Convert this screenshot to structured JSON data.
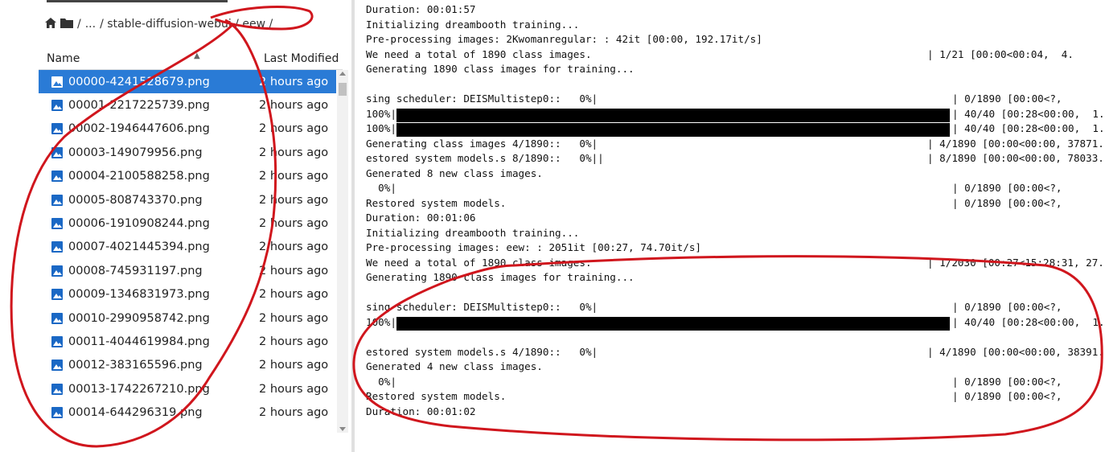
{
  "breadcrumb": {
    "root": "/",
    "ellipsis": "...",
    "path": "/ stable-diffusion-webui / eew /"
  },
  "file_browser": {
    "col_name": "Name",
    "col_modified": "Last Modified",
    "files": [
      {
        "name": "00000-4241528679.png",
        "modified": "2 hours ago",
        "selected": true
      },
      {
        "name": "00001-2217225739.png",
        "modified": "2 hours ago"
      },
      {
        "name": "00002-1946447606.png",
        "modified": "2 hours ago"
      },
      {
        "name": "00003-149079956.png",
        "modified": "2 hours ago"
      },
      {
        "name": "00004-2100588258.png",
        "modified": "2 hours ago"
      },
      {
        "name": "00005-808743370.png",
        "modified": "2 hours ago"
      },
      {
        "name": "00006-1910908244.png",
        "modified": "2 hours ago"
      },
      {
        "name": "00007-4021445394.png",
        "modified": "2 hours ago"
      },
      {
        "name": "00008-745931197.png",
        "modified": "2 hours ago"
      },
      {
        "name": "00009-1346831973.png",
        "modified": "2 hours ago"
      },
      {
        "name": "00010-2990958742.png",
        "modified": "2 hours ago"
      },
      {
        "name": "00011-4044619984.png",
        "modified": "2 hours ago"
      },
      {
        "name": "00012-383165596.png",
        "modified": "2 hours ago"
      },
      {
        "name": "00013-1742267210.png",
        "modified": "2 hours ago"
      },
      {
        "name": "00014-644296319.png",
        "modified": "2 hours ago"
      }
    ]
  },
  "console": [
    {
      "text": "Duration: 00:01:57",
      "right": "",
      "bar_progress": null
    },
    {
      "text": "Initializing dreambooth training...",
      "right": "",
      "bar_progress": null
    },
    {
      "text": "Pre-processing images: 2Kwomanregular: : 42it [00:00, 192.17it/s]",
      "right": "",
      "bar_progress": null
    },
    {
      "text": "We need a total of 1890 class images.",
      "right": "| 1/21 [00:00<00:04,  4.",
      "bar_progress": null
    },
    {
      "text": "Generating 1890 class images for training...",
      "right": "",
      "bar_progress": null
    },
    {
      "text": "",
      "right": "",
      "bar_progress": null
    },
    {
      "text": "sing scheduler: DEISMultistep0::   0%|",
      "right": "| 0/1890 [00:00<?,",
      "bar_progress": null
    },
    {
      "text": "100%|",
      "right": "| 40/40 [00:28<00:00,  1.",
      "bar_progress": 1.0
    },
    {
      "text": "100%|",
      "right": "| 40/40 [00:28<00:00,  1.",
      "bar_progress": 1.0
    },
    {
      "text": "Generating class images 4/1890::   0%|",
      "right": "| 4/1890 [00:00<00:00, 37871.",
      "bar_progress": null
    },
    {
      "text": "estored system models.s 8/1890::   0%||",
      "right": "| 8/1890 [00:00<00:00, 78033.",
      "bar_progress": null
    },
    {
      "text": "Generated 8 new class images.",
      "right": "",
      "bar_progress": null
    },
    {
      "text": "  0%|",
      "right": "| 0/1890 [00:00<?,",
      "bar_progress": null
    },
    {
      "text": "Restored system models.",
      "right": "| 0/1890 [00:00<?,",
      "bar_progress": null
    },
    {
      "text": "Duration: 00:01:06",
      "right": "",
      "bar_progress": null
    },
    {
      "text": "Initializing dreambooth training...",
      "right": "",
      "bar_progress": null
    },
    {
      "text": "Pre-processing images: eew: : 2051it [00:27, 74.70it/s]",
      "right": "",
      "bar_progress": null
    },
    {
      "text": "We need a total of 1890 class images.",
      "right": "| 1/2030 [00:27<15:28:31, 27.",
      "bar_progress": null
    },
    {
      "text": "Generating 1890 class images for training...",
      "right": "",
      "bar_progress": null
    },
    {
      "text": "",
      "right": "",
      "bar_progress": null
    },
    {
      "text": "sing scheduler: DEISMultistep0::   0%|",
      "right": "| 0/1890 [00:00<?,",
      "bar_progress": null
    },
    {
      "text": "100%|",
      "right": "| 40/40 [00:28<00:00,  1.",
      "bar_progress": 1.0
    },
    {
      "text": "",
      "right": "",
      "bar_progress": null
    },
    {
      "text": "estored system models.s 4/1890::   0%|",
      "right": "| 4/1890 [00:00<00:00, 38391.",
      "bar_progress": null
    },
    {
      "text": "Generated 4 new class images.",
      "right": "",
      "bar_progress": null
    },
    {
      "text": "  0%|",
      "right": "| 0/1890 [00:00<?,",
      "bar_progress": null
    },
    {
      "text": "Restored system models.",
      "right": "| 0/1890 [00:00<?,",
      "bar_progress": null
    },
    {
      "text": "Duration: 00:01:02",
      "right": "",
      "bar_progress": null
    }
  ],
  "colors": {
    "selection": "#2a7bd6",
    "file_icon": "#1a68c5",
    "annotation": "#d0161d"
  },
  "icons": {
    "home": "home-icon",
    "folder": "folder-icon",
    "file": "image-file-icon"
  }
}
